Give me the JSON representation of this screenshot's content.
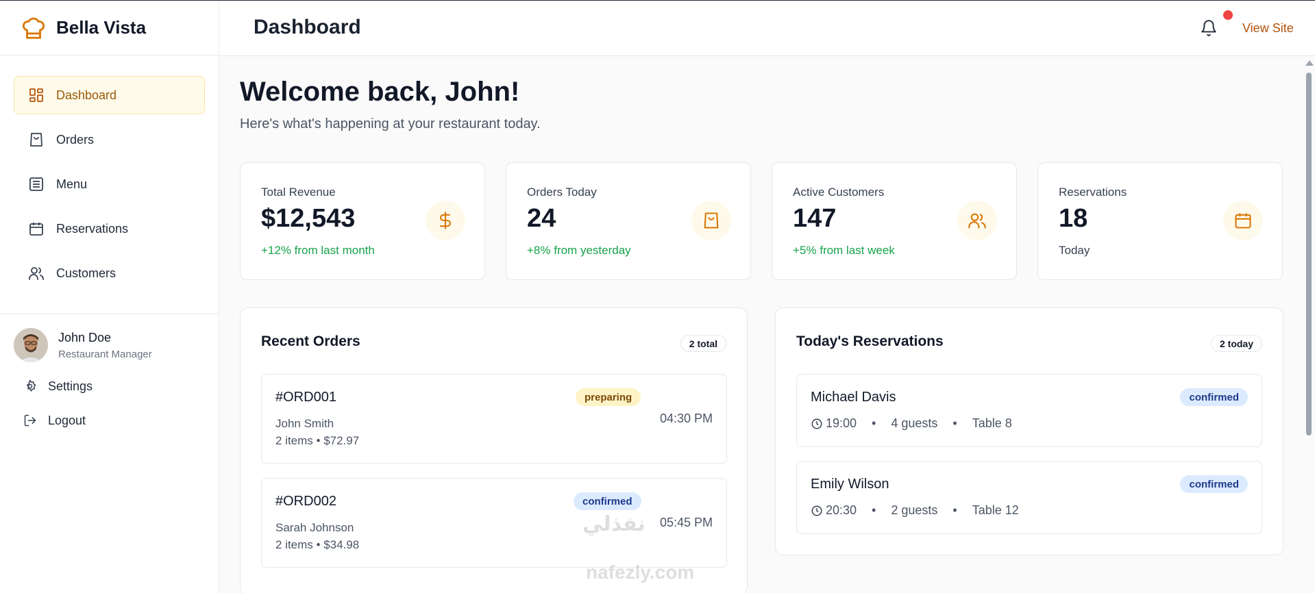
{
  "brand": {
    "name": "Bella Vista"
  },
  "sidebar": {
    "items": [
      {
        "label": "Dashboard",
        "icon": "dashboard-icon",
        "active": true
      },
      {
        "label": "Orders",
        "icon": "shopping-bag-icon"
      },
      {
        "label": "Menu",
        "icon": "menu-list-icon"
      },
      {
        "label": "Reservations",
        "icon": "calendar-icon"
      },
      {
        "label": "Customers",
        "icon": "users-icon"
      }
    ],
    "user": {
      "name": "John Doe",
      "role": "Restaurant Manager"
    },
    "settings_label": "Settings",
    "logout_label": "Logout"
  },
  "header": {
    "title": "Dashboard",
    "view_site": "View Site"
  },
  "main": {
    "welcome": "Welcome back, John!",
    "subtitle": "Here's what's happening at your restaurant today.",
    "stats": [
      {
        "label": "Total Revenue",
        "value": "$12,543",
        "trend": "+12% from last month",
        "icon": "dollar-icon"
      },
      {
        "label": "Orders Today",
        "value": "24",
        "trend": "+8% from yesterday",
        "icon": "shopping-bag-icon"
      },
      {
        "label": "Active Customers",
        "value": "147",
        "trend": "+5% from last week",
        "icon": "users-icon"
      },
      {
        "label": "Reservations",
        "value": "18",
        "trend": "Today",
        "icon": "calendar-icon"
      }
    ],
    "recent_orders": {
      "title": "Recent Orders",
      "badge": "2 total",
      "orders": [
        {
          "id": "#ORD001",
          "status": "preparing",
          "customer": "John Smith",
          "meta": "2 items • $72.97",
          "time": "04:30 PM"
        },
        {
          "id": "#ORD002",
          "status": "confirmed",
          "customer": "Sarah Johnson",
          "meta": "2 items • $34.98",
          "time": "05:45 PM"
        }
      ]
    },
    "reservations": {
      "title": "Today's Reservations",
      "badge": "2 today",
      "items": [
        {
          "name": "Michael Davis",
          "status": "confirmed",
          "time": "19:00",
          "guests": "4 guests",
          "table": "Table 8"
        },
        {
          "name": "Emily Wilson",
          "status": "confirmed",
          "time": "20:30",
          "guests": "2 guests",
          "table": "Table 12"
        }
      ]
    }
  },
  "watermark": {
    "arabic": "نفذلي",
    "latin": "nafezly.com"
  },
  "colors": {
    "accent": "#b45309",
    "active_bg": "#fefbea",
    "green": "#16a34a",
    "notify": "#ef4444"
  }
}
